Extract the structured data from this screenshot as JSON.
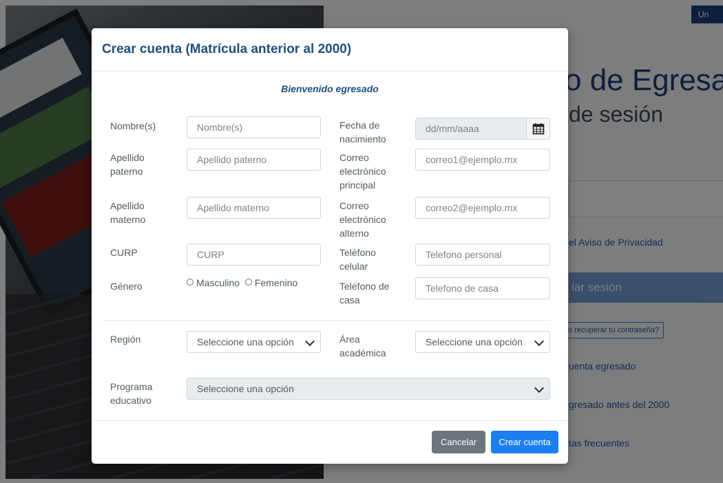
{
  "background": {
    "top_button": "Un",
    "title": "o de Egresad",
    "subtitle": "de sesión",
    "privacy_link": "el Aviso de Privacidad",
    "login_button": "iar sesión",
    "recover_link": "o recuperar tu contraseña?",
    "links": [
      "uenta egresado",
      "gresado antes del 2000",
      "tas frecuentes"
    ]
  },
  "modal": {
    "title": "Crear cuenta (Matrícula anterior al 2000)",
    "welcome": "Bienvenido egresado",
    "fields": {
      "nombre": {
        "label": "Nombre(s)",
        "placeholder": "Nombre(s)"
      },
      "apellido_paterno": {
        "label": "Apellido paterno",
        "placeholder": "Apellido paterno"
      },
      "apellido_materno": {
        "label": "Apellido materno",
        "placeholder": "Apellido materno"
      },
      "curp": {
        "label": "CURP",
        "placeholder": "CURP"
      },
      "genero": {
        "label": "Género",
        "options": [
          "Masculino",
          "Femenino"
        ]
      },
      "fecha_nacimiento": {
        "label": "Fecha de nacimiento",
        "placeholder": "dd/mm/aaaa"
      },
      "correo_principal": {
        "label": "Correo electrónico principal",
        "placeholder": "correo1@ejemplo.mx"
      },
      "correo_alterno": {
        "label": "Correo electrónico alterno",
        "placeholder": "correo2@ejemplo.mx"
      },
      "telefono_celular": {
        "label": "Teléfono celular",
        "placeholder": "Telefono personal"
      },
      "telefono_casa": {
        "label": "Teléfono de casa",
        "placeholder": "Telefono de casa"
      },
      "region": {
        "label": "Región",
        "value": "Seleccione una opción"
      },
      "area_academica": {
        "label": "Área académica",
        "value": "Seleccione una opción"
      },
      "programa_educativo": {
        "label": "Programa educativo",
        "value": "Seleccione una opción"
      }
    },
    "buttons": {
      "cancel": "Cancelar",
      "create": "Crear cuenta"
    }
  },
  "icons": {
    "calendar": "calendar-icon",
    "chevron": "chevron-down-icon"
  },
  "colors": {
    "title": "#1f4f7f",
    "primary_button": "#1b7ff0",
    "cancel_button": "#6c757d",
    "brand_blue": "#1d3f7a"
  }
}
